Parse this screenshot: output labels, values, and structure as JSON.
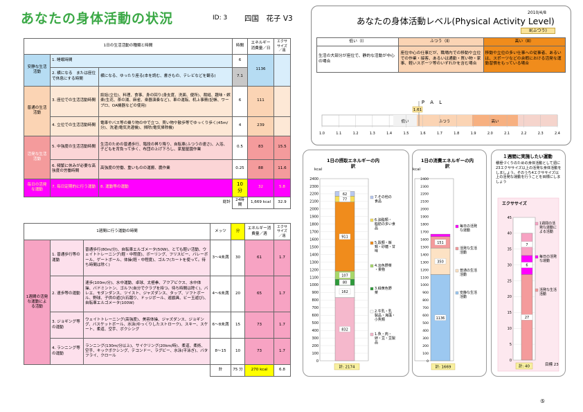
{
  "header": {
    "title": "あなたの身体活動の状況",
    "id": "ID: 3",
    "name": "四国　花子 V3"
  },
  "right": {
    "title": "あなたの身体活動レベル(Physical Activity Level)",
    "date": "2010/4/8",
    "level_badge": "Ⅱ(ふつう)",
    "levels": [
      {
        "head": "低い（Ⅰ）",
        "desc": "生活の大部分が座位で、静的な活動が中心の場合"
      },
      {
        "head": "ふつう（Ⅱ）",
        "desc": "座位中心の仕事だが、職場内での移動や立位での作業・接客、あるいは通勤・買い物・家事、軽いスポーツ等のいずれかを含む場合"
      },
      {
        "head": "高い（Ⅲ）",
        "desc": "移動や立位の多い仕事への従事者、あるいは、スポーツなどの余暇における活発な運動習慣をもっている場合"
      }
    ],
    "pal_label": "P A L",
    "pal_value": "1.61",
    "pal_band_low": "低い",
    "pal_band_mid": "ふつう",
    "pal_band_high": "高い",
    "pal_ticks": [
      "1.0",
      "1.1",
      "1.2",
      "1.3",
      "1.4",
      "1.5",
      "1.6",
      "1.7",
      "1.8",
      "1.9",
      "2.0",
      "2.1",
      "2.2",
      "2.3",
      "2.4"
    ]
  },
  "table1": {
    "head_activity": "1日の生活活動の種類と時間",
    "head_time": "時間",
    "head_energy": "エネルギー消費量／日",
    "head_ex": "エクササイズ／週",
    "rows": [
      {
        "cat": "安静な生活活動",
        "num": "1. 睡眠時間",
        "desc": "",
        "time": "6",
        "energy": "1136",
        "ex": ""
      },
      {
        "cat": "",
        "num": "2. 横になる　または座位で休息にする時間",
        "desc": "横になる、ゆったり座る(本を読む、書きもの、テレビなどを観る)",
        "time": "7.1",
        "energy": "",
        "ex": ""
      },
      {
        "cat": "普通の生活活動",
        "num": "3. 座位での生活活動時間",
        "desc": "談話(立位)、料理、食事、身の回り(身支度、洗面、便所)、裁縫、趣味・娯楽(生花、茶の湯、麻雀、楽器演奏など)、車の運転、机上事務(記帳、ワープロ、OA機器などの使用)",
        "time": "6",
        "energy": "111",
        "ex": ""
      },
      {
        "cat": "",
        "num": "4. 立位での生活活動時間",
        "desc": "電車やバス等の乗り物の中で立つ、買い物や散歩等でゆっくり歩く(45m/分)、洗濯(電気洗濯機)、掃除(電気掃除機)",
        "time": "4",
        "energy": "239",
        "ex": ""
      },
      {
        "cat": "活発な生活活動",
        "num": "5. 中強度の生活活動時間",
        "desc": "生活のための普通歩行、階段の昇り降り、自転車(ふつうの速さ)、入浴、子どもを背負って歩く、布団の上げ下ろし、家屋屋園作業",
        "time": "0.5",
        "energy": "83",
        "ex": "15.5"
      },
      {
        "cat": "",
        "num": "6. 頻繁に休みが必要な高強度の労働時間",
        "desc": "高強度の労働、重いものの運搬、農作業",
        "time": "0.25",
        "energy": "88",
        "ex": "11.6"
      },
      {
        "cat": "毎日の活発な運動",
        "num": "7. 毎日定期的に行う運動",
        "desc": "8. 運動等の運動",
        "time": "10 分",
        "energy": "32",
        "ex": "5.8"
      }
    ],
    "total_label": "総計",
    "total_time": "24時間",
    "total_energy": "1,669 kcal",
    "total_ex": "32.9"
  },
  "table2": {
    "head_activity": "1週間に行う運動の時間",
    "head_mets": "メッツ",
    "head_min": "分",
    "head_energy": "エネルギー消費量／週",
    "head_ex": "エクササイズ／週",
    "cat": "1週間の活発な運動による活動",
    "rows": [
      {
        "num": "1. 普通歩行等の運動",
        "desc": "普通歩行(80m/分)、自転車エルゴメータ(50W)、とても軽い活動、ウェイトトレーニング(軽・中程度)、ボーリング、フリスビー、バレーボール、ゲートボール、体操(軽・中程度)、ゴルフ(カートを使って。待ち時間は除く)",
        "mets": "3～4未満",
        "min": "30",
        "energy": "61",
        "ex": "1.7"
      },
      {
        "num": "2. 速歩等の運動",
        "desc": "速歩(100m/分)、水中運動、卓球、太極拳、アクアビクス、水中体操、バドミントン、ゴルフ(自分でクラブを持つ。待ち時間は除く)、バレエ、モダンダンス、ツイスト、ジャズダンス、タップ、ソフトボール、野球、子供の遊び(石蹴り、ドッジボール、遊戯具、ビー玉遊び)、自転車エルゴメータ(100W)",
        "mets": "4～6未満",
        "min": "20",
        "energy": "65",
        "ex": "1.7"
      },
      {
        "num": "3. ジョギング等の運動",
        "desc": "ウェイトトレーニング(高強度)、美容体操、ジャズダンス、ジョギング、バスケットボール、水泳(ゆっくりしたストローク)、スキー、スケート、柔道、空手、ボクシング",
        "mets": "6～8未満",
        "min": "15",
        "energy": "73",
        "ex": "1.7"
      },
      {
        "num": "4. ランニング等の運動",
        "desc": "ランニング(130m/分以上)、サイクリング(20km/時)、柔道、柔術、空手、キックボクシング、テコンドー、ラグビー、水泳(平泳ぎ)、バタフライ、クロール",
        "mets": "8～15",
        "min": "10",
        "energy": "73",
        "ex": "1.7"
      }
    ],
    "total_label": "計",
    "total_min": "75 分",
    "total_energy": "270 kcal",
    "total_ex": "6.8"
  },
  "chart_data": [
    {
      "type": "bar",
      "title": "1日の摂取エネルギーの内訳",
      "ylabel": "kcal",
      "ylim": [
        0,
        2400
      ],
      "yticks": [
        "2400",
        "2300",
        "2200",
        "2100",
        "2000",
        "1900",
        "1800",
        "1700",
        "1600",
        "1500",
        "1400",
        "1300",
        "1200",
        "1100",
        "1000",
        "900",
        "800",
        "700",
        "600",
        "500",
        "400",
        "300",
        "200",
        "100",
        "0"
      ],
      "stack": [
        {
          "name": "1.魚・肉・卵・豆・豆製品",
          "value": 832,
          "label": "832",
          "color": "#f5b8cc"
        },
        {
          "name": "2.牛乳・乳製品・海藻・小魚類",
          "value": 162,
          "label": "162",
          "color": "#ffffff"
        },
        {
          "name": "3.緑黄色野菜",
          "value": 80,
          "label": "80",
          "color": "#2e9a3a"
        },
        {
          "name": "4.淡色野菜・果物",
          "value": 107,
          "label": "107",
          "color": "#a8d86a"
        },
        {
          "name": "5.穀類・飯類・砂糖・甘味",
          "value": 911,
          "label": "911",
          "color": "#f08c1c"
        },
        {
          "name": "6.油脂類・脂肪の多い食品",
          "value": 77,
          "label": "77",
          "color": "#f7e05a"
        },
        {
          "name": "7.その他の食品",
          "value": 62,
          "label": "62",
          "color": "#b8c8f0"
        }
      ],
      "total": "計: 2174"
    },
    {
      "type": "bar",
      "title": "1日の消費エネルギーの内訳",
      "ylabel": "kcal",
      "ylim": [
        0,
        2400
      ],
      "stack": [
        {
          "name": "安静な生活活動",
          "value": 1136,
          "label": "1136",
          "color": "#9cc8f0"
        },
        {
          "name": "普通の生活活動",
          "value": 350,
          "label": "350",
          "color": "#fde2c4"
        },
        {
          "name": "活発な生活活動",
          "value": 151,
          "label": "151",
          "color": "#f49b9c"
        },
        {
          "name": "毎日の活発な運動",
          "value": 32,
          "label": "",
          "color": "#ff00ff"
        }
      ],
      "total": "計: 1669"
    },
    {
      "type": "bar",
      "title": "エクササイズ",
      "ylim": [
        0,
        45
      ],
      "yticks": [
        "45",
        "40",
        "35",
        "30",
        "25",
        "20",
        "15",
        "10",
        "5",
        "0"
      ],
      "stack": [
        {
          "name": "活発な生活活動",
          "value": 27,
          "label": "27",
          "color": "#f49b9c"
        },
        {
          "name": "毎日の活発な運動",
          "value": 6,
          "label": "6",
          "color": "#ff00ff"
        },
        {
          "name": "1週間の活発な運動による活動",
          "value": 7,
          "label": "7",
          "color": "#f7a3c3"
        }
      ],
      "total": "計: 40",
      "goal": "目標 23"
    }
  ],
  "week_panel": {
    "title": "１週間に実施したい運動",
    "text": "積極づくりのための身体活動として週に23エクササイズ以上の活発な身体活動をしましょう。そのうち4エクササイズ以上の活発な運動を行うことを目標にしましょう"
  },
  "page_number": "⑤"
}
